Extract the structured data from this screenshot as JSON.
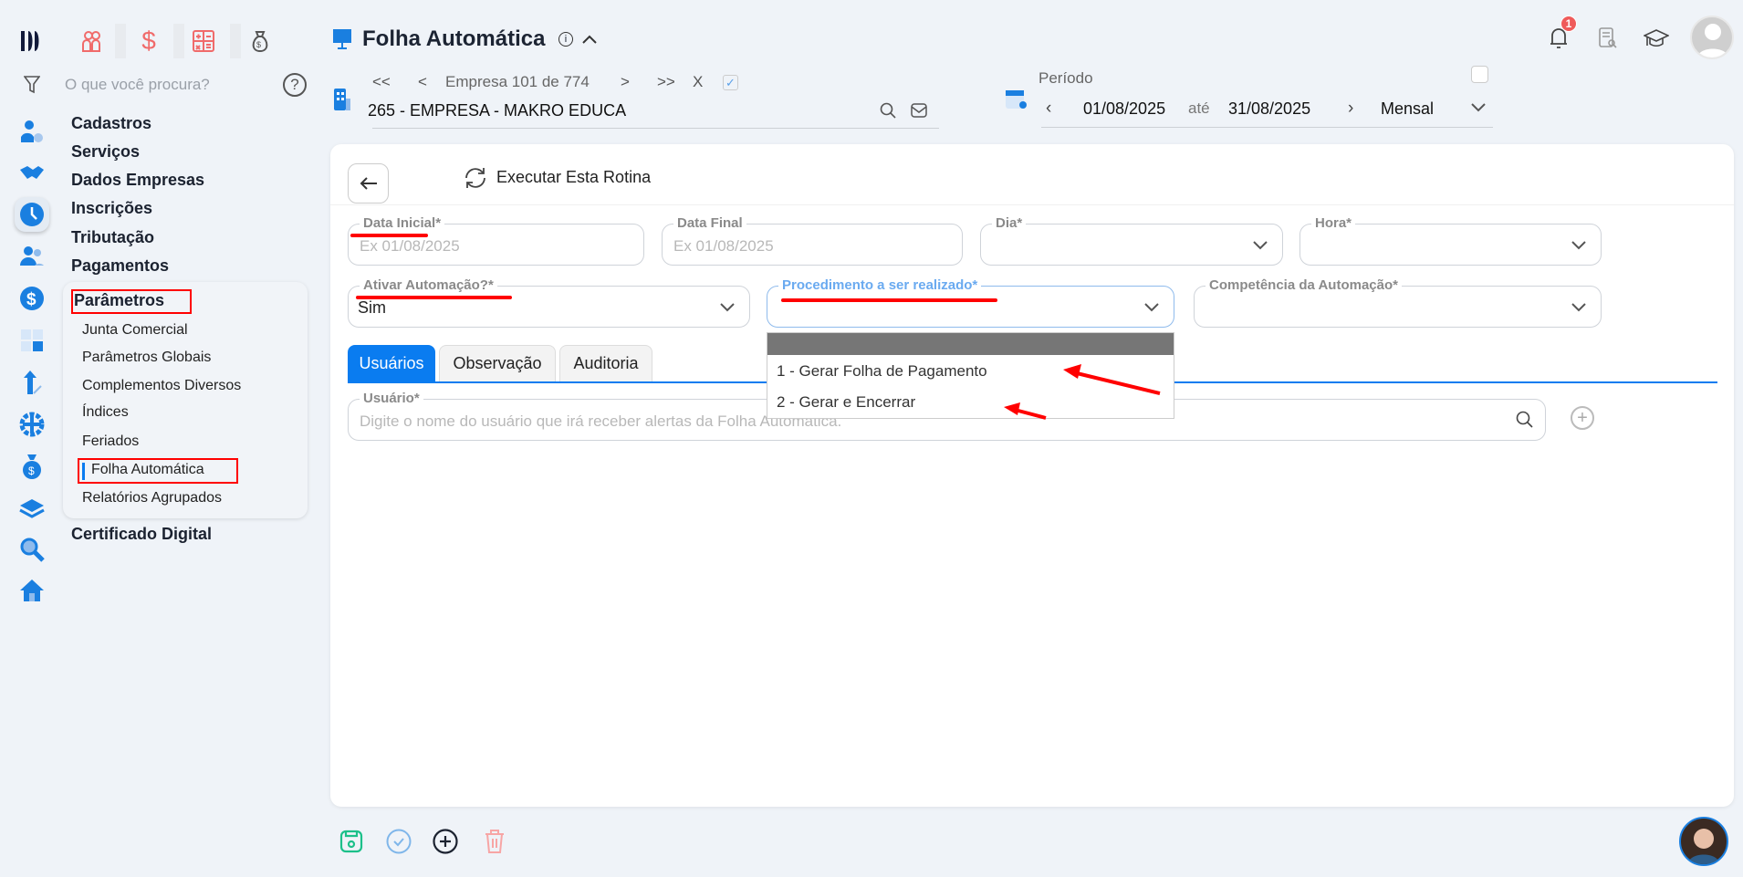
{
  "app": {
    "title": "Folha Automática"
  },
  "top_modules": [
    {
      "icon": "users-icon",
      "color": "#f06b6b"
    },
    {
      "icon": "dollar-icon",
      "color": "#f06b6b"
    },
    {
      "icon": "calculator-icon",
      "color": "#f06b6b"
    },
    {
      "icon": "money-bag-icon",
      "color": "#555"
    }
  ],
  "search": {
    "placeholder": "O que você procura?"
  },
  "menu": {
    "items": [
      "Cadastros",
      "Serviços",
      "Dados Empresas",
      "Inscrições",
      "Tributação",
      "Pagamentos"
    ],
    "section": "Parâmetros",
    "sub_items": [
      "Junta Comercial",
      "Parâmetros Globais",
      "Complementos Diversos",
      "Índices",
      "Feriados",
      "Folha Automática",
      "Relatórios Agrupados"
    ],
    "active_sub": "Folha Automática",
    "after": "Certificado Digital"
  },
  "company_nav": {
    "first": "<<",
    "prev": "<",
    "label": "Empresa 101 de 774",
    "next": ">",
    "last": ">>",
    "clear": "X",
    "company": "265 - EMPRESA - MAKRO EDUCA"
  },
  "period": {
    "label": "Período",
    "start": "01/08/2025",
    "sep": "até",
    "end": "31/08/2025",
    "mode": "Mensal"
  },
  "notifications": {
    "count": "1"
  },
  "toolbar": {
    "execute": "Executar Esta Rotina"
  },
  "form": {
    "data_inicial": {
      "label": "Data Inicial*",
      "placeholder": "Ex 01/08/2025"
    },
    "data_final": {
      "label": "Data Final",
      "placeholder": "Ex 01/08/2025"
    },
    "dia": {
      "label": "Dia*"
    },
    "hora": {
      "label": "Hora*"
    },
    "ativar": {
      "label": "Ativar Automação?*",
      "value": "Sim"
    },
    "procedimento": {
      "label": "Procedimento a ser realizado*",
      "options": [
        "1 - Gerar Folha de Pagamento",
        "2 - Gerar e Encerrar"
      ]
    },
    "competencia": {
      "label": "Competência da Automação*"
    },
    "usuario": {
      "label": "Usuário*",
      "placeholder": "Digite o nome do usuário que irá receber alertas da Folha Automática."
    }
  },
  "tabs": [
    "Usuários",
    "Observação",
    "Auditoria"
  ],
  "active_tab": "Usuários",
  "colors": {
    "accent": "#0a7cf0",
    "annotation": "#ff0000",
    "save": "#1cc08a",
    "delete": "#f7a5a5"
  }
}
